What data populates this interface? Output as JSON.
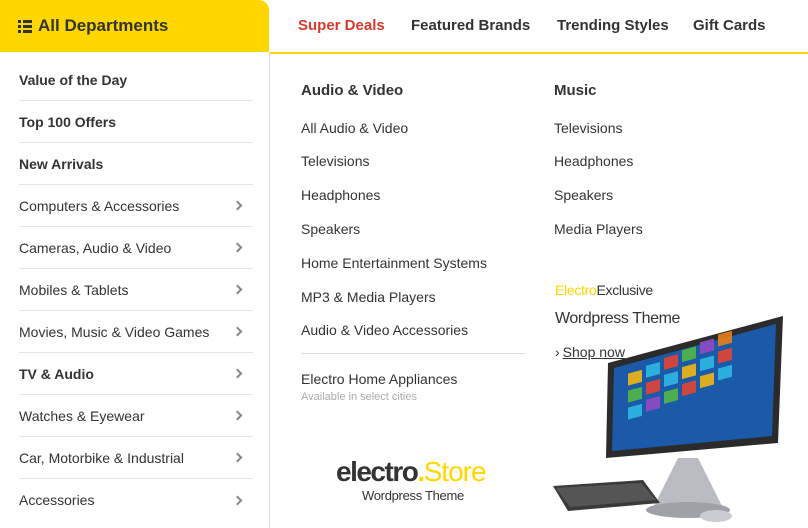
{
  "departments": {
    "label": "All Departments",
    "icon": "list-icon"
  },
  "topnav": [
    {
      "label": "Super Deals",
      "active": true
    },
    {
      "label": "Featured Brands"
    },
    {
      "label": "Trending Styles"
    },
    {
      "label": "Gift Cards"
    }
  ],
  "sidebar": {
    "items": [
      {
        "label": "Value of the Day",
        "bold": true,
        "chevron": false
      },
      {
        "label": "Top 100 Offers",
        "bold": true,
        "chevron": false
      },
      {
        "label": "New Arrivals",
        "bold": true,
        "chevron": false
      },
      {
        "label": "Computers & Accessories",
        "chevron": true
      },
      {
        "label": "Cameras, Audio & Video",
        "chevron": true
      },
      {
        "label": "Mobiles & Tablets",
        "chevron": true
      },
      {
        "label": "Movies, Music & Video Games",
        "chevron": true
      },
      {
        "label": "TV & Audio",
        "bold": true,
        "chevron": true
      },
      {
        "label": "Watches & Eyewear",
        "chevron": true
      },
      {
        "label": "Car, Motorbike & Industrial",
        "chevron": true
      },
      {
        "label": "Accessories",
        "chevron": true
      }
    ]
  },
  "megamenu": {
    "col1": {
      "title": "Audio & Video",
      "links": [
        "All Audio & Video",
        "Televisions",
        "Headphones",
        "Speakers",
        "Home Entertainment Systems",
        "MP3 & Media Players",
        "Audio & Video Accessories"
      ],
      "extra_link": "Electro Home Appliances",
      "extra_note": "Available in select cities"
    },
    "col2": {
      "title": "Music",
      "links": [
        "Televisions",
        "Headphones",
        "Speakers",
        "Media Players"
      ]
    }
  },
  "promo": {
    "brand": "Electro",
    "exclusive": "Exclusive",
    "theme": "Wordpress Theme",
    "cta": "Shop now",
    "cta_arrow": "›"
  },
  "logo": {
    "word": "electro",
    "dot": ".",
    "store": "Store",
    "subtitle": "Wordpress Theme"
  },
  "colors": {
    "accent": "#fed700",
    "active": "#d43a2f",
    "text": "#333333"
  }
}
